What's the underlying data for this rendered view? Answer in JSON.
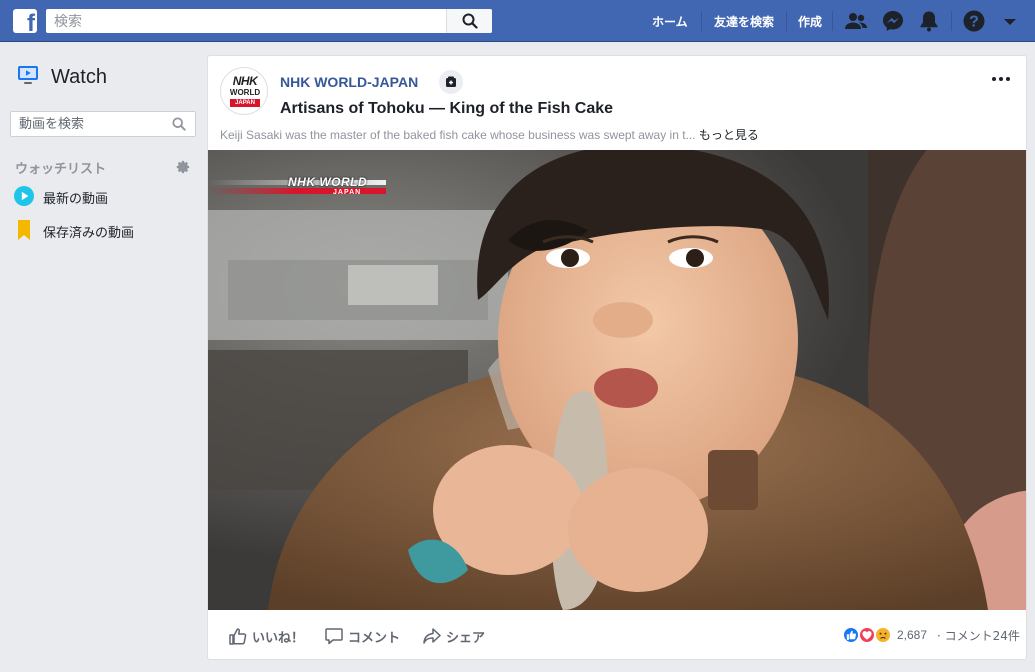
{
  "topbar": {
    "logo": "f",
    "search_placeholder": "検索",
    "nav": [
      "ホーム",
      "友達を検索",
      "作成"
    ],
    "icons": [
      "friends-icon",
      "messenger-icon",
      "bell-icon",
      "help-icon",
      "caret-down-icon"
    ],
    "brand_color": "#4267b2"
  },
  "sidebar": {
    "title": "Watch",
    "search_placeholder": "動画を検索",
    "watchlist_label": "ウォッチリスト",
    "items": [
      {
        "label": "最新の動画",
        "icon": "play-icon"
      },
      {
        "label": "保存済みの動画",
        "icon": "bookmark-icon"
      }
    ]
  },
  "post": {
    "page_name": "NHK WORLD-JAPAN",
    "avatar_lines": [
      "NHK",
      "WORLD",
      "JAPAN"
    ],
    "title": "Artisans of Tohoku — King of the Fish Cake",
    "description": "Keiji Sasaki was the master of the baked fish cake whose business was swept away in t...",
    "see_more": "もっと見る",
    "watermark": {
      "line1": "NHK WORLD",
      "line2": "JAPAN"
    },
    "actions": {
      "like": "いいね！",
      "comment": "コメント",
      "share": "シェア"
    },
    "reaction_count": "2,687",
    "comment_count": "· コメント24件"
  }
}
